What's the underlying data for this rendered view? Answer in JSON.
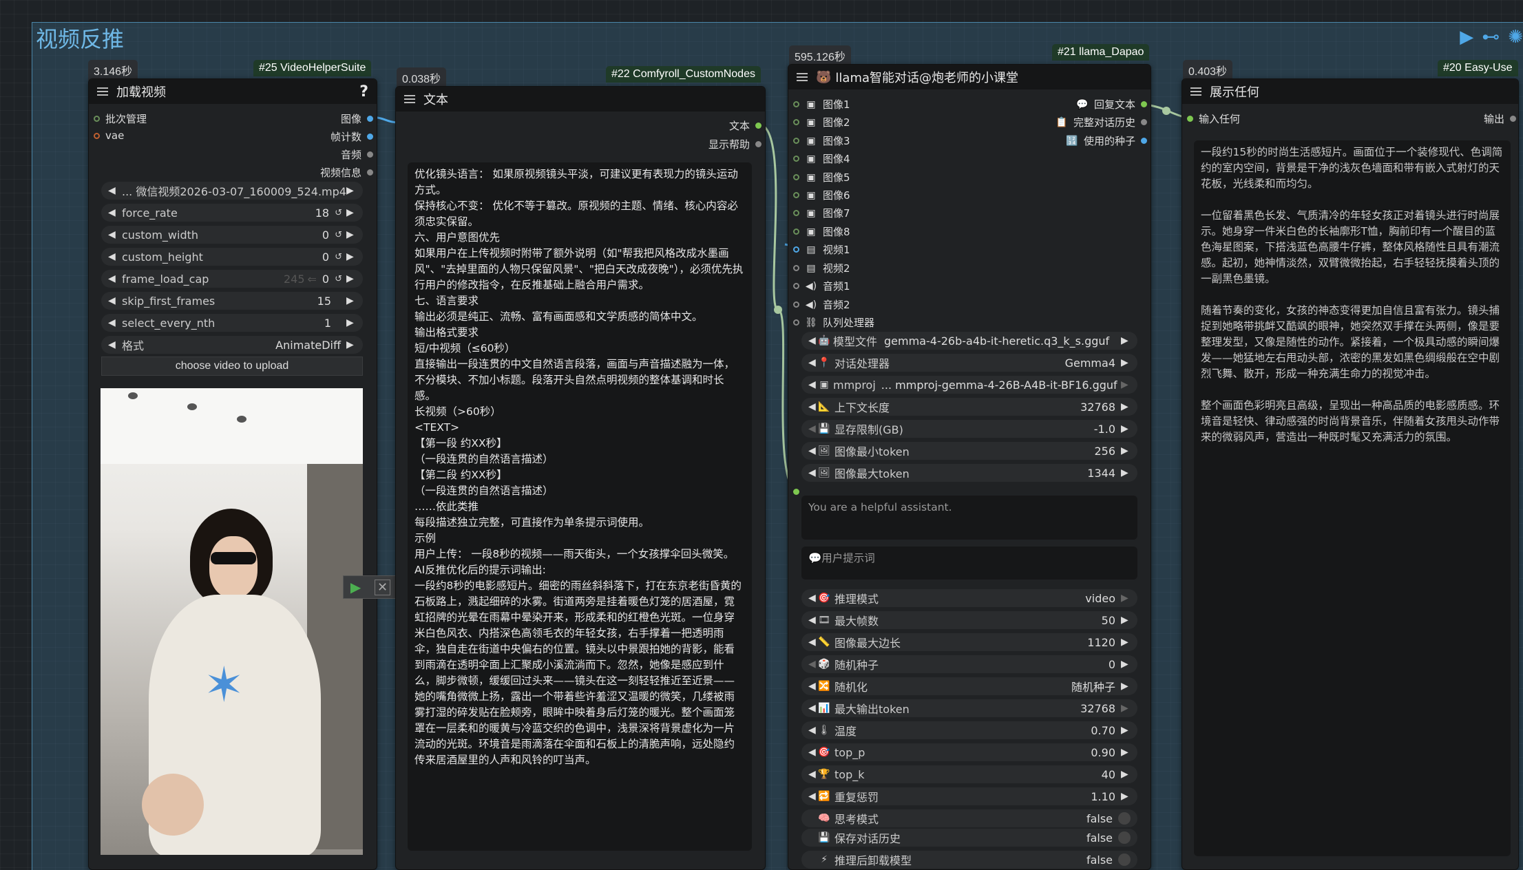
{
  "group": {
    "title": "视频反推"
  },
  "node25": {
    "time": "3.146秒",
    "id": "#25 VideoHelperSuite",
    "title": "加载视频",
    "help": "?",
    "inputs": [
      "批次管理",
      "vae"
    ],
    "outputs": [
      "图像",
      "帧计数",
      "音频",
      "视频信息"
    ],
    "widgets": [
      {
        "label": "... 微信视频2026-03-07_160009_524.mp4",
        "value": ""
      },
      {
        "label": "force_rate",
        "value": "18"
      },
      {
        "label": "custom_width",
        "value": "0"
      },
      {
        "label": "custom_height",
        "value": "0"
      },
      {
        "label": "frame_load_cap",
        "value": "0",
        "hint": "245"
      },
      {
        "label": "skip_first_frames",
        "value": "15"
      },
      {
        "label": "select_every_nth",
        "value": "1"
      },
      {
        "label": "格式",
        "value": "AnimateDiff"
      }
    ],
    "upload_label": "choose video to upload"
  },
  "node22": {
    "time": "0.038秒",
    "id": "#22 Comfyroll_CustomNodes",
    "title": "文本",
    "outputs": [
      "文本",
      "显示帮助"
    ],
    "text": [
      "优化镜头语言： 如果原视频镜头平淡，可建议更有表现力的镜头运动方式。",
      "保持核心不变： 优化不等于篡改。原视频的主题、情绪、核心内容必须忠实保留。",
      "六、用户意图优先",
      "如果用户在上传视频时附带了额外说明（如\"帮我把风格改成水墨画风\"、\"去掉里面的人物只保留风景\"、\"把白天改成夜晚\"），必须优先执行用户的修改指令，在反推基础上融合用户需求。",
      "",
      "七、语言要求",
      "输出必须是纯正、流畅、富有画面感和文学质感的简体中文。",
      "",
      "输出格式要求",
      "短/中视频（≤60秒）",
      "直接输出一段连贯的中文自然语言段落，画面与声音描述融为一体，不分模块、不加小标题。段落开头自然点明视频的整体基调和时长感。",
      "",
      "长视频（>60秒）",
      "<TEXT>",
      "【第一段 约XX秒】",
      "（一段连贯的自然语言描述）",
      "【第二段 约XX秒】",
      "（一段连贯的自然语言描述）",
      "……依此类推",
      "每段描述独立完整，可直接作为单条提示词使用。",
      "",
      "示例",
      "用户上传： 一段8秒的视频——雨天街头，一个女孩撑伞回头微笑。",
      "",
      "AI反推优化后的提示词输出:",
      "",
      "一段约8秒的电影感短片。细密的雨丝斜斜落下，打在东京老街昏黄的石板路上，溅起细碎的水雾。街道两旁是挂着暖色灯笼的居酒屋，霓虹招牌的光晕在雨幕中晕染开来，形成柔和的红橙色光斑。一位身穿米白色风衣、内搭深色高领毛衣的年轻女孩，右手撑着一把透明雨伞，独自走在街道中央偏右的位置。镜头以中景跟拍她的背影，能看到雨滴在透明伞面上汇聚成小溪流淌而下。忽然，她像是感应到什么，脚步微顿，缓缓回过头来——镜头在这一刻轻轻推近至近景——她的嘴角微微上扬，露出一个带着些许羞涩又温暖的微笑，几缕被雨雾打湿的碎发贴在脸颊旁，眼眸中映着身后灯笼的暖光。整个画面笼罩在一层柔和的暖黄与冷蓝交织的色调中，浅景深将背景虚化为一片流动的光斑。环境音是雨滴落在伞面和石板上的清脆声响，远处隐约传来居酒屋里的人声和风铃的叮当声。"
    ]
  },
  "node21": {
    "time": "595.126秒",
    "id": "#21 llama_Dapao",
    "title": "llama智能对话@炮老师的小课堂",
    "inputs": [
      "图像1",
      "图像2",
      "图像3",
      "图像4",
      "图像5",
      "图像6",
      "图像7",
      "图像8",
      "视频1",
      "视频2",
      "音频1",
      "音频2",
      "队列处理器"
    ],
    "outputs": [
      "回复文本",
      "完整对话历史",
      "使用的种子"
    ],
    "widgets_top": [
      {
        "label": "模型文件",
        "value": "gemma-4-26b-a4b-it-heretic.q3_k_s.gguf"
      },
      {
        "label": "对话处理器",
        "value": "Gemma4"
      },
      {
        "label": "mmproj",
        "value": "... mmproj-gemma-4-26B-A4B-it-BF16.gguf"
      },
      {
        "label": "上下文长度",
        "value": "32768"
      },
      {
        "label": "显存限制(GB)",
        "value": "-1.0"
      },
      {
        "label": "图像最小token",
        "value": "256"
      },
      {
        "label": "图像最大token",
        "value": "1344"
      }
    ],
    "system_prompt": "You are a helpful assistant.",
    "user_prompt_placeholder": "💬用户提示词",
    "widgets_bottom": [
      {
        "label": "推理模式",
        "value": "video"
      },
      {
        "label": "最大帧数",
        "value": "50"
      },
      {
        "label": "图像最大边长",
        "value": "1120"
      },
      {
        "label": "随机种子",
        "value": "0"
      },
      {
        "label": "随机化",
        "value": "随机种子"
      },
      {
        "label": "最大输出token",
        "value": "32768"
      },
      {
        "label": "温度",
        "value": "0.70"
      },
      {
        "label": "top_p",
        "value": "0.90"
      },
      {
        "label": "top_k",
        "value": "40"
      },
      {
        "label": "重复惩罚",
        "value": "1.10"
      }
    ],
    "toggles": [
      {
        "label": "思考模式",
        "value": "false"
      },
      {
        "label": "保存对话历史",
        "value": "false"
      },
      {
        "label": "推理后卸载模型",
        "value": "false"
      }
    ]
  },
  "node20": {
    "time": "0.403秒",
    "id": "#20 Easy-Use",
    "title": "展示任何",
    "input": "输入任何",
    "output": "输出",
    "text": [
      "一段约15秒的时尚生活感短片。画面位于一个装修现代、色调简约的室内空间，背景是干净的浅灰色墙面和带有嵌入式射灯的天花板，光线柔和而均匀。",
      "一位留着黑色长发、气质清冷的年轻女孩正对着镜头进行时尚展示。她身穿一件米白色的长袖廓形T恤，胸前印有一个醒目的蓝色海星图案，下搭浅蓝色高腰牛仔裤，整体风格随性且具有潮流感。起初，她神情淡然，双臂微微抬起，右手轻轻抚摸着头顶的一副黑色墨镜。",
      "随着节奏的变化，女孩的神态变得更加自信且富有张力。镜头捕捉到她略带挑衅又酷飒的眼神，她突然双手撑在头两侧，像是要整理发型，又像是随性的动作。紧接着，一个极具动感的瞬间爆发——她猛地左右甩动头部，浓密的黑发如黑色绸缎般在空中剧烈飞舞、散开，形成一种充满生命力的视觉冲击。",
      "整个画面色彩明亮且高级，呈现出一种高品质的电影感质感。环境音是轻快、律动感强的时尚背景音乐，伴随着女孩甩头动作带来的微弱风声，营造出一种既时髦又充满活力的氛围。"
    ]
  },
  "colors": {
    "accent": "#4fa8e8",
    "group": "#4a86a8",
    "text": "#dddddd"
  }
}
